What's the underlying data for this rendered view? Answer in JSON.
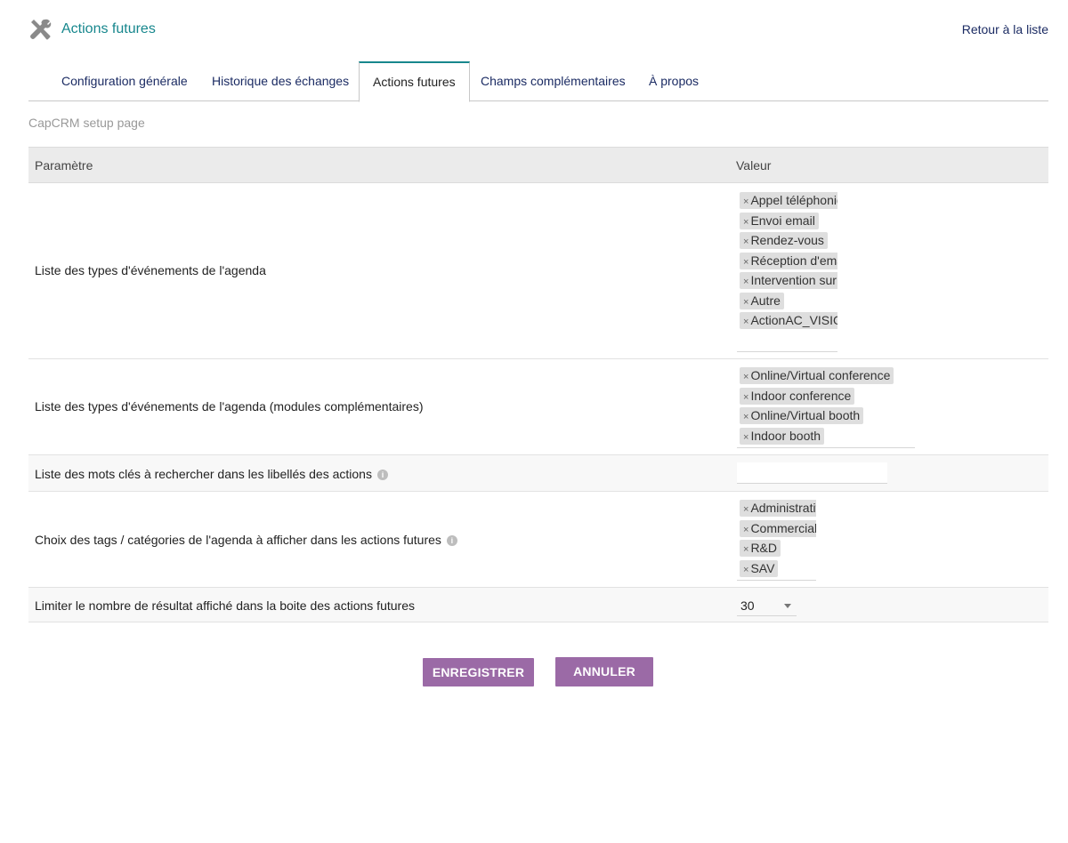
{
  "header": {
    "icon": "tools-icon",
    "title": "Actions futures",
    "back_link": "Retour à la liste"
  },
  "tabs": [
    {
      "label": "Configuration générale",
      "active": false
    },
    {
      "label": "Historique des échanges",
      "active": false
    },
    {
      "label": "Actions futures",
      "active": true
    },
    {
      "label": "Champs complémentaires",
      "active": false
    },
    {
      "label": "À propos",
      "active": false
    }
  ],
  "subtitle": "CapCRM setup page",
  "table": {
    "headers": {
      "param": "Paramètre",
      "value": "Valeur"
    },
    "rows": [
      {
        "label": "Liste des types d'événements de l'agenda",
        "chips": [
          "Appel téléphonique",
          "Envoi email",
          "Rendez-vous",
          "Réception d'email",
          "Intervention sur site",
          "Autre",
          "ActionAC_VISIO"
        ]
      },
      {
        "label": "Liste des types d'événements de l'agenda (modules complémentaires)",
        "chips": [
          "Online/Virtual conference",
          "Indoor conference",
          "Online/Virtual booth",
          "Indoor booth"
        ]
      },
      {
        "label": "Liste des mots clés à rechercher dans les libellés des actions",
        "input_value": ""
      },
      {
        "label": "Choix des tags / catégories de l'agenda à afficher dans les actions futures",
        "chips": [
          "Administratif",
          "Commercial",
          "R&D",
          "SAV"
        ]
      },
      {
        "label": "Limiter le nombre de résultat affiché dans la boite des actions futures",
        "select_value": "30"
      }
    ]
  },
  "buttons": {
    "save": "ENREGISTRER",
    "cancel": "ANNULER"
  },
  "colors": {
    "accent": "#17878d",
    "button": "#9b6aa6",
    "link": "#1b2b63"
  }
}
